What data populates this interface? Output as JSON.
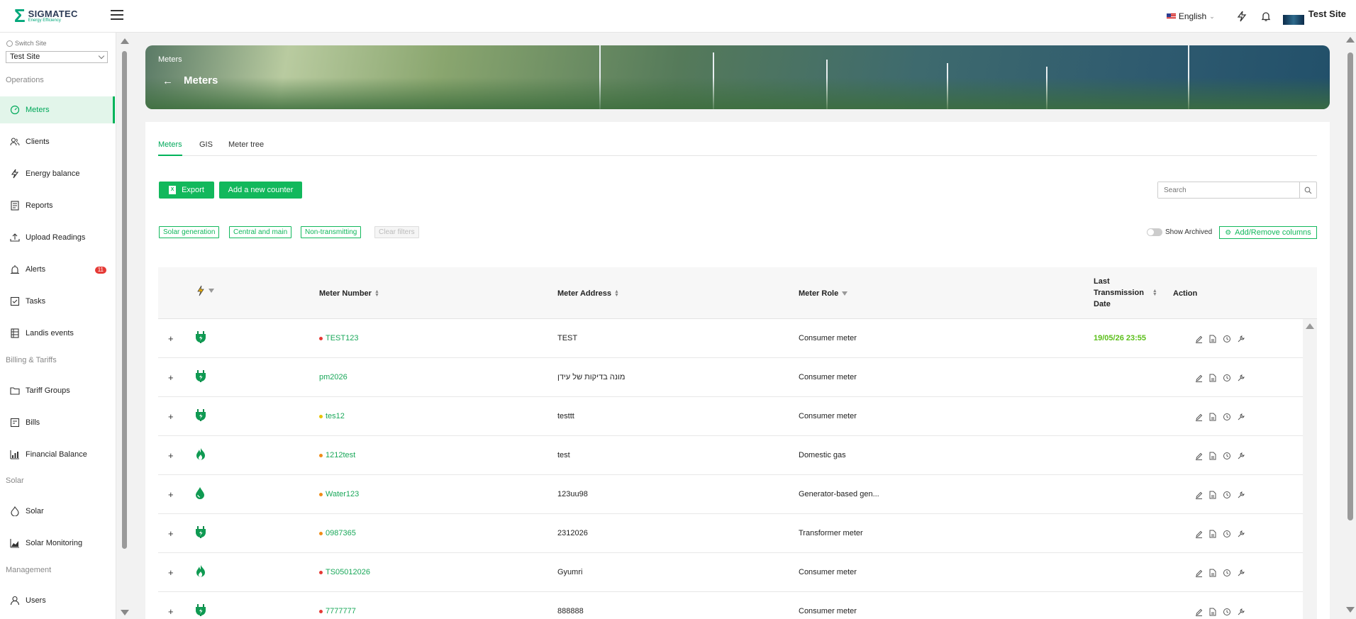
{
  "brand": {
    "name": "SIGMATEC",
    "tagline": "Energy Efficiency"
  },
  "header": {
    "language": "English",
    "site_name": "Test Site"
  },
  "sidebar": {
    "switch_site_label": "Switch Site",
    "site_value": "Test Site",
    "sections": {
      "operations": "Operations",
      "billing": "Billing & Tariffs",
      "solar": "Solar",
      "management": "Management"
    },
    "items": [
      {
        "label": "Meters"
      },
      {
        "label": "Clients"
      },
      {
        "label": "Energy balance"
      },
      {
        "label": "Reports"
      },
      {
        "label": "Upload Readings"
      },
      {
        "label": "Alerts",
        "badge": "11"
      },
      {
        "label": "Tasks"
      },
      {
        "label": "Landis events"
      },
      {
        "label": "Tariff Groups"
      },
      {
        "label": "Bills"
      },
      {
        "label": "Financial Balance"
      },
      {
        "label": "Solar"
      },
      {
        "label": "Solar Monitoring"
      },
      {
        "label": "Users"
      }
    ]
  },
  "banner": {
    "breadcrumb": "Meters",
    "title": "Meters"
  },
  "tabs": [
    "Meters",
    "GIS",
    "Meter tree"
  ],
  "toolbar": {
    "export_label": "Export",
    "xl_glyph": "X",
    "add_label": "Add a new counter",
    "search_placeholder": "Search"
  },
  "filters": {
    "chips": [
      "Solar generation",
      "Central and main",
      "Non-transmitting"
    ],
    "clear": "Clear filters",
    "show_archived": "Show Archived",
    "add_remove": "Add/Remove columns"
  },
  "table": {
    "headers": {
      "number": "Meter Number",
      "address": "Meter Address",
      "role": "Meter Role",
      "last_tx_1": "Last",
      "last_tx_2": "Transmission",
      "last_tx_3": "Date",
      "action": "Action"
    },
    "rows": [
      {
        "type": "electric",
        "status": "red",
        "number": "TEST123",
        "address": "TEST",
        "role": "Consumer meter",
        "date": "19/05/26 23:55"
      },
      {
        "type": "electric",
        "status": "none",
        "number": "pm2026",
        "address": "מונה בדיקות של עידן",
        "role": "Consumer meter",
        "date": ""
      },
      {
        "type": "electric",
        "status": "yellow",
        "number": "tes12",
        "address": "testtt",
        "role": "Consumer meter",
        "date": ""
      },
      {
        "type": "gas",
        "status": "orange",
        "number": "1212test",
        "address": "test",
        "role": "Domestic gas",
        "date": ""
      },
      {
        "type": "water",
        "status": "orange",
        "number": "Water123",
        "address": "123uu98",
        "role": "Generator-based gen...",
        "date": ""
      },
      {
        "type": "electric",
        "status": "orange",
        "number": "0987365",
        "address": "2312026",
        "role": "Transformer meter",
        "date": ""
      },
      {
        "type": "gas",
        "status": "red",
        "number": "TS05012026",
        "address": "Gyumri",
        "role": "Consumer meter",
        "date": ""
      },
      {
        "type": "electric",
        "status": "red",
        "number": "7777777",
        "address": "888888",
        "role": "Consumer meter",
        "date": ""
      }
    ]
  },
  "colors": {
    "accent": "#12b85c",
    "active_bg": "#e2f5ea",
    "alert": "#e53935"
  }
}
